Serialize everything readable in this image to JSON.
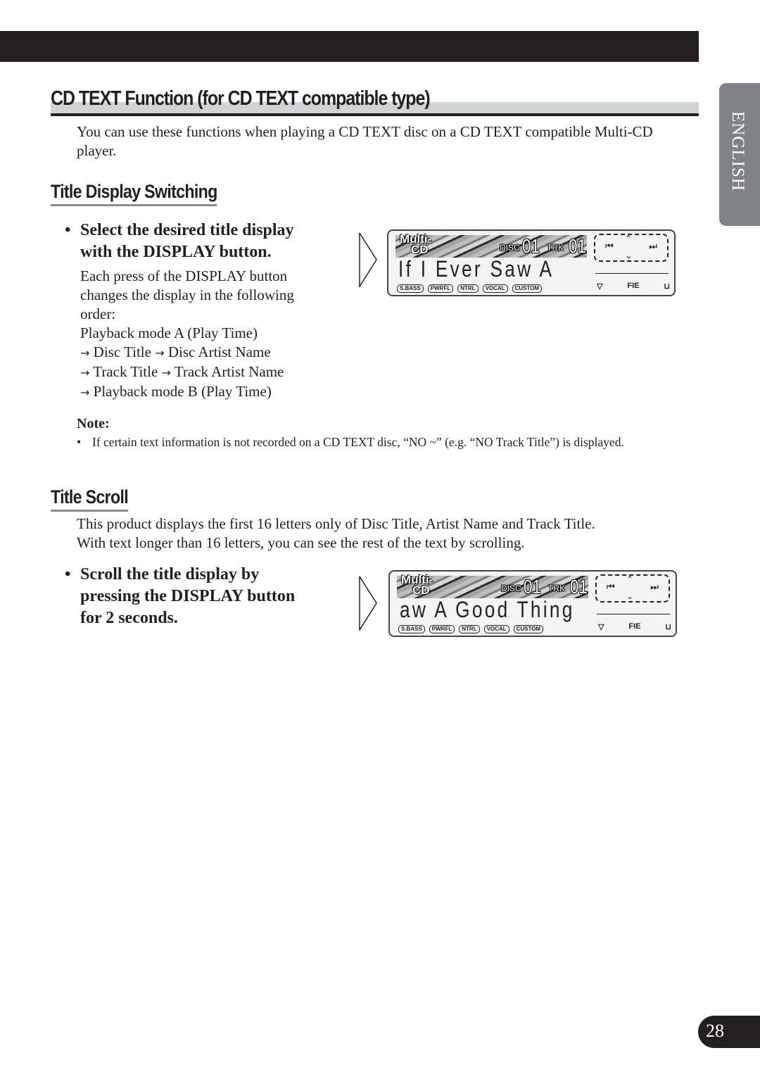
{
  "header": {
    "title": "CD TEXT Function (for CD TEXT compatible type)"
  },
  "intro": "You can use these functions when playing a CD TEXT disc on a CD TEXT compatible Multi-CD player.",
  "side_tab": {
    "label": "ENGLISH"
  },
  "section1": {
    "title": "Title Display Switching",
    "bullet_line1": "Select the desired title display",
    "bullet_line2": "with the DISPLAY button.",
    "body_lines": [
      "Each press of the DISPLAY button",
      "changes the display in the following",
      "order:",
      "Playback mode A (Play Time)"
    ],
    "sequence": [
      [
        "Disc Title",
        "Disc Artist Name"
      ],
      [
        "Track Title",
        "Track Artist Name"
      ],
      [
        "Playback mode B (Play Time)"
      ]
    ],
    "arrow_icon": "→"
  },
  "note": {
    "title": "Note:",
    "item": "If certain text information is not recorded on a CD TEXT disc, “NO ~” (e.g. “NO Track Title”) is displayed."
  },
  "section2": {
    "title": "Title Scroll",
    "body": [
      "This product displays the first 16 letters only of Disc Title, Artist Name and Track Title.",
      "With text longer than 16 letters, you can see the rest of the text by scrolling."
    ],
    "bullet_lines": [
      "Scroll the title display by",
      "pressing the DISPLAY button",
      "for 2 seconds."
    ]
  },
  "displays": [
    {
      "logo1": "Multi-",
      "logo2": "CD",
      "disc_label": "DISC",
      "disc": "01",
      "trk_label": "TRK",
      "trk": "01",
      "text": "If I Ever Saw A",
      "eq": [
        "S.BASS",
        "PWRFL",
        "NTRL",
        "VOCAL",
        "CUSTOM"
      ],
      "fie": "FIE"
    },
    {
      "logo1": "Multi-",
      "logo2": "CD",
      "disc_label": "DISC",
      "disc": "01",
      "trk_label": "TRK",
      "trk": "01",
      "text": "aw A Good Thing",
      "eq": [
        "S.BASS",
        "PWRFL",
        "NTRL",
        "VOCAL",
        "CUSTOM"
      ],
      "fie": "FIE"
    }
  ],
  "page_number": "28"
}
